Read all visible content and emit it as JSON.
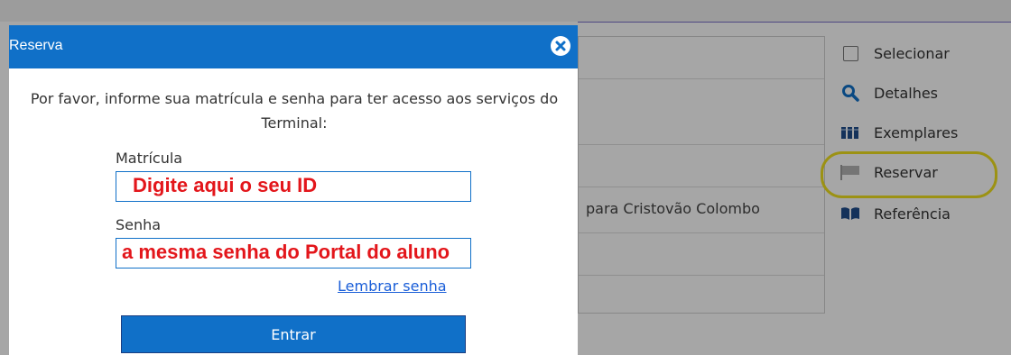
{
  "dialog": {
    "title": "Reserva",
    "message": "Por favor, informe sua matrícula e senha para ter acesso aos serviços do Terminal:",
    "matricula_label": "Matrícula",
    "matricula_value": "Digite aqui o seu ID",
    "senha_label": "Senha",
    "senha_value": "a mesma senha do Portal do aluno",
    "forgot_link": "Lembrar senha",
    "submit_label": "Entrar"
  },
  "result": {
    "visible_text": "para Cristovão Colombo"
  },
  "actions": {
    "items": [
      {
        "label": "Selecionar",
        "icon": "checkbox-icon"
      },
      {
        "label": "Detalhes",
        "icon": "search-icon"
      },
      {
        "label": "Exemplares",
        "icon": "books-icon"
      },
      {
        "label": "Reservar",
        "icon": "flag-icon"
      },
      {
        "label": "Referência",
        "icon": "book-open-icon"
      }
    ]
  },
  "colors": {
    "header_blue": "#1070c8",
    "highlight_yellow": "#f0e020",
    "annotation_red": "#e3161b"
  }
}
